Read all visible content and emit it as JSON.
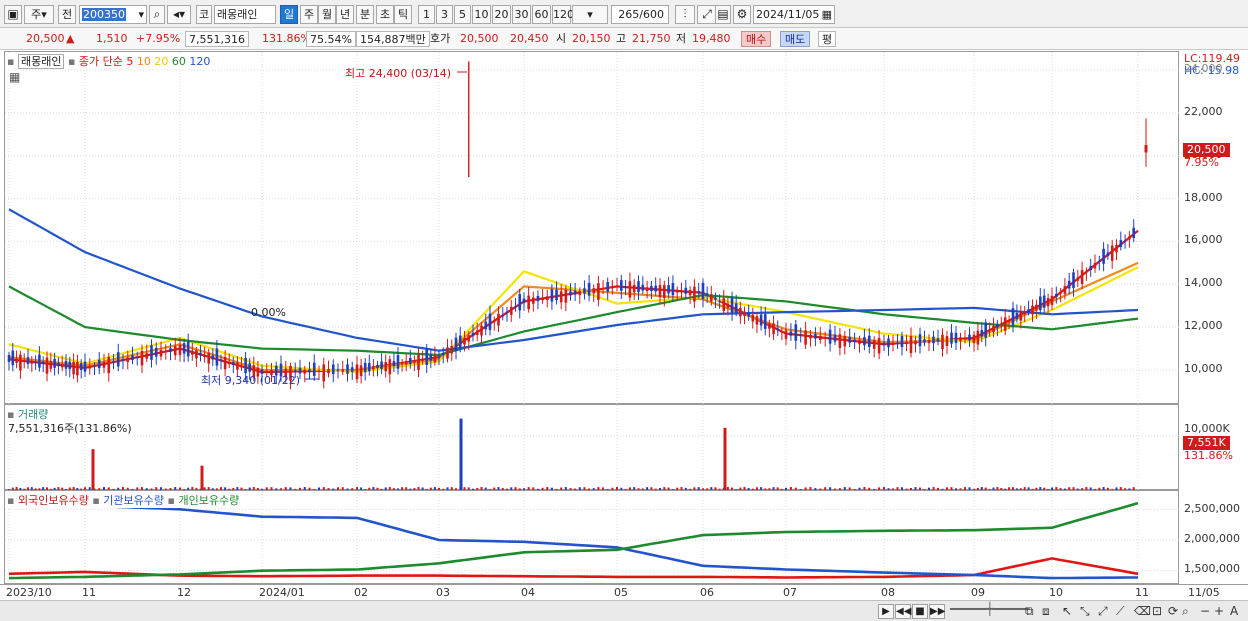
{
  "toolbar": {
    "period_type": "주",
    "prev_label": "전",
    "stock_code": "200350",
    "market_label": "코",
    "stock_name": "래몽래인",
    "periods": [
      "일",
      "주",
      "월",
      "년",
      "분",
      "초",
      "틱"
    ],
    "active_period": "일",
    "intervals": [
      "1",
      "3",
      "5",
      "10",
      "20",
      "30",
      "60",
      "120"
    ],
    "count_value": "265",
    "count_total": "/600",
    "date": "2024/11/05"
  },
  "quote": {
    "price": "20,500",
    "change_arrow": "▲",
    "change": "1,510",
    "change_pct": "+7.95%",
    "volume": "7,551,316",
    "volume_pct": "131.86%",
    "turnover_pct": "75.54%",
    "amount": "154,887백만",
    "ask_label": "호가",
    "ask": "20,500",
    "bid": "20,450",
    "open_label": "시",
    "open": "20,150",
    "high_label": "고",
    "high": "21,750",
    "low_label": "저",
    "low": "19,480",
    "buy_label": "매수",
    "sell_label": "매도",
    "eval_label": "평"
  },
  "price_panel": {
    "legend_name": "래몽래인",
    "legend_ma": "종가 단순",
    "ma_periods": [
      "5",
      "10",
      "20",
      "60",
      "120"
    ],
    "ma_colors": [
      "#e01515",
      "#f08a1a",
      "#f5e400",
      "#1e8a2e",
      "#2255cc"
    ],
    "lc_label": "LC:119.49",
    "hc_label": "HC:-15.98",
    "yticks": [
      "10,000",
      "12,000",
      "14,000",
      "16,000",
      "18,000",
      "20,000",
      "22,000",
      "24,000"
    ],
    "current_price_tag": "20,500",
    "current_pct": "7.95%",
    "high_note": "최고 24,400 (03/14)",
    "low_note": "최저 9,340 (01/22)",
    "mid_note": "0.00%"
  },
  "volume_panel": {
    "title": "거래량",
    "value_label": "7,551,316주(131.86%)",
    "ytick": "10,000K",
    "current_tag": "7,551K",
    "current_pct": "131.86%"
  },
  "holding_panel": {
    "legends": [
      "외국인보유수량",
      "기관보유수량",
      "개인보유수량"
    ],
    "yticks": [
      "1,500,000",
      "2,000,000",
      "2,500,000"
    ]
  },
  "xaxis": {
    "labels": [
      "2023/10",
      "11",
      "12",
      "2024/01",
      "02",
      "03",
      "04",
      "05",
      "06",
      "07",
      "08",
      "09",
      "10",
      "11"
    ],
    "last_label": "11/05"
  },
  "chart_data": [
    {
      "type": "line",
      "title": "",
      "y_axis_ticks": [
        10000,
        12000,
        14000,
        16000,
        18000,
        20000,
        22000,
        24000
      ],
      "ylim": [
        9000,
        24500
      ],
      "x": [
        "2023/10",
        "11",
        "12",
        "2024/01",
        "02",
        "03",
        "04",
        "05",
        "06",
        "07",
        "08",
        "09",
        "10",
        "11"
      ],
      "series": [
        {
          "name": "5",
          "color": "#e01515",
          "values": [
            10500,
            10100,
            11000,
            9900,
            10000,
            10600,
            13200,
            13900,
            13600,
            11700,
            11200,
            11500,
            13300,
            16500
          ]
        },
        {
          "name": "10",
          "color": "#f08a1a",
          "values": [
            10600,
            10200,
            11200,
            10000,
            10000,
            10500,
            13900,
            13600,
            13300,
            11900,
            11300,
            11400,
            13200,
            15000
          ]
        },
        {
          "name": "20",
          "color": "#f5e400",
          "values": [
            11200,
            10300,
            11500,
            10200,
            9900,
            10400,
            14600,
            13100,
            13400,
            12700,
            11700,
            11300,
            12800,
            14800
          ]
        },
        {
          "name": "60",
          "color": "#1e8a2e",
          "values": [
            13900,
            12000,
            11400,
            11000,
            10900,
            10700,
            11800,
            12700,
            13500,
            13200,
            12600,
            12200,
            11900,
            12400
          ]
        },
        {
          "name": "120",
          "color": "#2255cc",
          "values": [
            17500,
            15500,
            13800,
            12500,
            11500,
            10900,
            11400,
            12100,
            12600,
            12700,
            12800,
            12900,
            12600,
            12800
          ]
        }
      ],
      "annotations": [
        "최고 24,400 (03/14)",
        "최저 9,340 (01/22)"
      ],
      "last_close": 20500
    },
    {
      "type": "bar",
      "title": "거래량",
      "ylabel_tick": "10,000K",
      "x": [
        "2023/10",
        "11",
        "12",
        "2024/01",
        "02",
        "03",
        "04",
        "05",
        "06",
        "07",
        "08",
        "09",
        "10",
        "11"
      ],
      "spikes": [
        {
          "x": "12",
          "value_k": 4500
        },
        {
          "x": "03",
          "value_k": 13200
        },
        {
          "x": "06",
          "value_k": 11500
        },
        {
          "x": "11",
          "value_k": 7551
        }
      ]
    },
    {
      "type": "line",
      "title": "",
      "y_axis_ticks": [
        1500000,
        2000000,
        2500000
      ],
      "x": [
        "2023/10",
        "11",
        "12",
        "2024/01",
        "02",
        "03",
        "04",
        "05",
        "06",
        "07",
        "08",
        "09",
        "10",
        "11"
      ],
      "series": [
        {
          "name": "외국인보유수량",
          "color": "#e01515",
          "values": [
            1450000,
            1480000,
            1420000,
            1410000,
            1420000,
            1420000,
            1410000,
            1400000,
            1400000,
            1390000,
            1400000,
            1430000,
            1700000,
            1450000
          ]
        },
        {
          "name": "기관보유수량",
          "color": "#2255cc",
          "values": [
            2600000,
            2560000,
            2500000,
            2380000,
            2360000,
            2000000,
            1970000,
            1880000,
            1580000,
            1520000,
            1470000,
            1430000,
            1380000,
            1390000
          ]
        },
        {
          "name": "개인보유수량",
          "color": "#1e8a2e",
          "values": [
            1380000,
            1400000,
            1440000,
            1500000,
            1520000,
            1620000,
            1800000,
            1840000,
            2080000,
            2130000,
            2150000,
            2160000,
            2200000,
            2600000
          ]
        }
      ]
    }
  ]
}
